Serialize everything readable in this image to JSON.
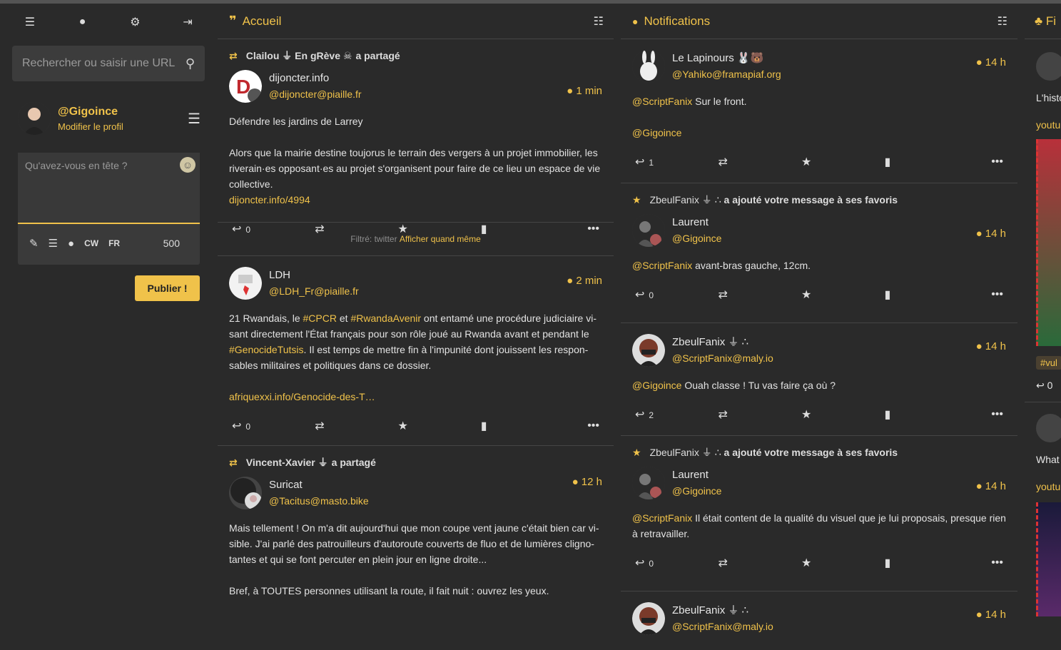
{
  "nav": {
    "menu_icon": "hamburger-icon",
    "globe_icon": "globe-icon",
    "settings_icon": "gear-icon",
    "logout_icon": "logout-icon"
  },
  "search": {
    "placeholder": "Rechercher ou saisir une URL"
  },
  "profile": {
    "handle": "@Gigoince",
    "edit_label": "Modifier le profil"
  },
  "compose": {
    "placeholder": "Qu'avez-vous en tête ?",
    "cw": "CW",
    "lang": "FR",
    "count": "500",
    "publish": "Publier !"
  },
  "home": {
    "title": "Accueil",
    "statuses": [
      {
        "boost_by": "Clailou ⏚ En gRève ☠",
        "boost_label": "a partagé",
        "display_name": "dijoncter.info",
        "username": "@dijoncter@piaille.fr",
        "time": "1 min",
        "paragraphs": [
          "Défendre les jardins de Larrey",
          "Alors que la mairie destine toujorus le terrain des vergers à un projet immobilier, les riverain·es opposant·es au projet s'organisent pour faire de ce lieu un espace de vie collective."
        ],
        "link": "dijoncter.info/4994",
        "replies": "0"
      },
      {
        "display_name": "LDH",
        "username": "@LDH_Fr@piaille.fr",
        "time": "2 min",
        "p1_a": "21 Rwandais, le ",
        "tag1": "#CPCR",
        "p1_b": " et ",
        "tag2": "#RwandaAvenir",
        "p1_c": " ont entamé une procédure judiciaire vi­sant directement l'État français pour son rôle joué au Rwanda avant et pendant le ",
        "tag3": "#GenocideTutsis",
        "p1_d": ". Il est temps de mettre fin à l'impunité dont jouissent les respon­sables militaires et politiques dans ce dossier.",
        "link": "afriquexxi.info/Genocide-des-T…",
        "replies": "0"
      },
      {
        "boost_by": "Vincent-Xavier ⏚",
        "boost_label": "a partagé",
        "display_name": "Suricat",
        "username": "@Tacitus@masto.bike",
        "time": "12 h",
        "paragraphs": [
          "Mais tellement ! On m'a dit aujourd'hui que mon coupe vent jaune c'était bien car vi­sible. J'ai parlé des patrouilleurs d'autoroute couverts de fluo et de lumières cligno­tantes et qui se font percuter en plein jour en ligne droite...",
          "Bref, à TOUTES personnes utilisant la route, il fait nuit : ouvrez les yeux."
        ]
      }
    ],
    "filtered": {
      "label": "Filtré: twitter",
      "action": "Afficher quand même"
    }
  },
  "notifications": {
    "title": "Notifications",
    "items": [
      {
        "display_name": "Le Lapinours 🐰🐻",
        "username": "@Yahiko@framapiaf.org",
        "time": "14 h",
        "mention": "@ScriptFanix",
        "text": " Sur le front.",
        "mention2": "@Gigoince",
        "replies": "1"
      },
      {
        "fav_by": "ZbeulFanix ⏚ ∴",
        "fav_label": "a ajouté votre message à ses favoris",
        "display_name": "Laurent",
        "username": "@Gigoince",
        "time": "14 h",
        "mention": "@ScriptFanix",
        "text": " avant-bras gauche, 12cm.",
        "replies": "0"
      },
      {
        "display_name": "ZbeulFanix ⏚ ∴",
        "username": "@ScriptFanix@maly.io",
        "time": "14 h",
        "mention": "@Gigoince",
        "text": " Ouah classe ! Tu vas faire ça où ?",
        "replies": "2"
      },
      {
        "fav_by": "ZbeulFanix ⏚ ∴",
        "fav_label": "a ajouté votre message à ses favoris",
        "display_name": "Laurent",
        "username": "@Gigoince",
        "time": "14 h",
        "mention": "@ScriptFanix",
        "text": " Il était content de la qualité du visuel que je lui proposais, presque rien à retravailler.",
        "replies": "0"
      },
      {
        "display_name": "ZbeulFanix ⏚ ∴",
        "username": "@ScriptFanix@maly.io",
        "time": "14 h"
      }
    ]
  },
  "extra": {
    "title": "Fi",
    "text1": "L'histo",
    "link1": "youtu",
    "tag": "#vul",
    "replies": "0",
    "text2": "What",
    "link2": "youtu"
  },
  "colors": {
    "accent": "#f0c24a",
    "background": "#2a2a2a",
    "divider": "#454545"
  }
}
